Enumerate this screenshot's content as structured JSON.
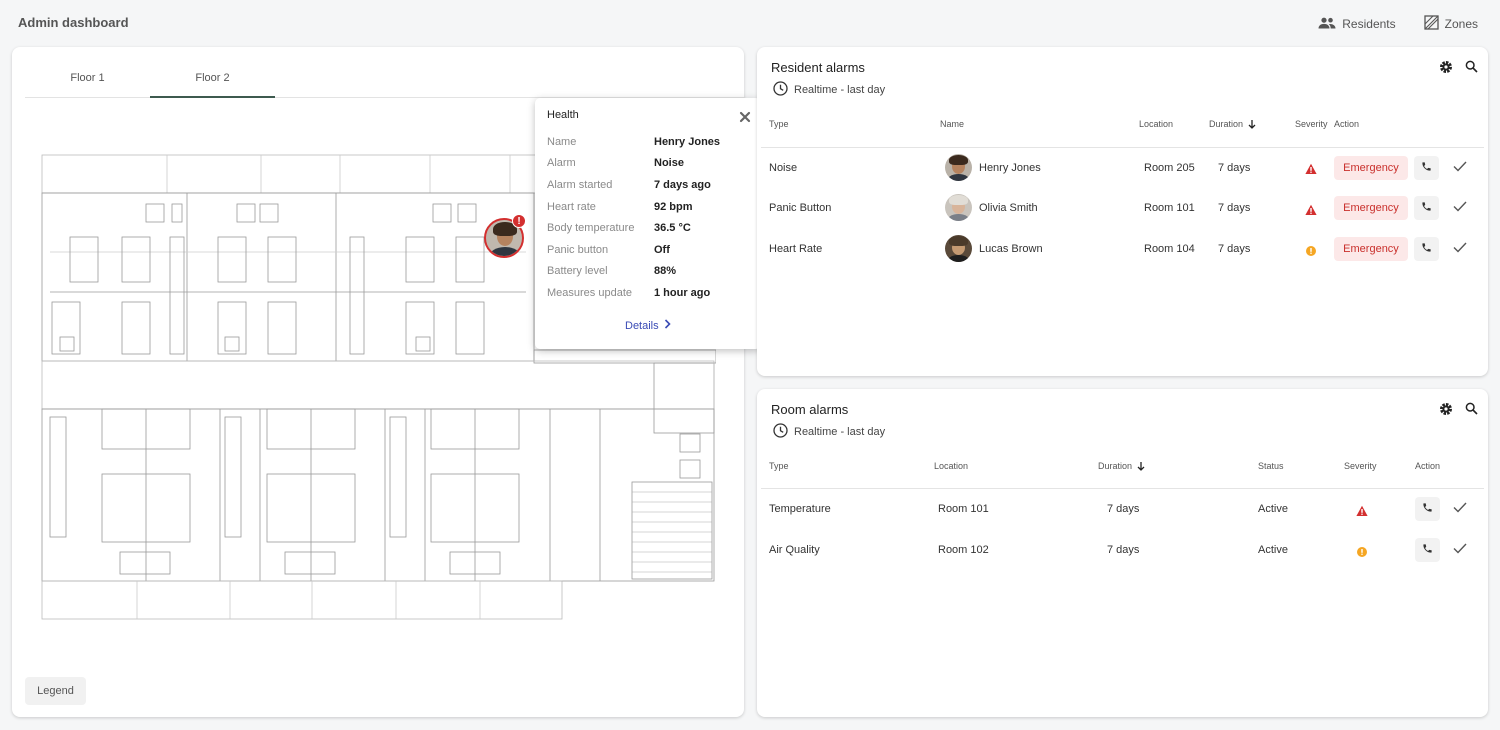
{
  "header": {
    "title": "Admin dashboard",
    "nav": [
      {
        "label": "Residents",
        "icon": "people-icon"
      },
      {
        "label": "Zones",
        "icon": "zones-icon"
      }
    ]
  },
  "map": {
    "tabs": [
      {
        "label": "Floor 1",
        "active": false
      },
      {
        "label": "Floor 2",
        "active": true
      }
    ],
    "legend_label": "Legend",
    "popup": {
      "title": "Health",
      "rows": [
        {
          "label": "Name",
          "value": "Henry Jones"
        },
        {
          "label": "Alarm",
          "value": "Noise"
        },
        {
          "label": "Alarm started",
          "value": "7 days ago"
        },
        {
          "label": "Heart rate",
          "value": "92 bpm"
        },
        {
          "label": "Body temperature",
          "value": "36.5 °C"
        },
        {
          "label": "Panic button",
          "value": "Off"
        },
        {
          "label": "Battery level",
          "value": "88%"
        },
        {
          "label": "Measures update",
          "value": "1 hour ago"
        }
      ],
      "details_label": "Details",
      "badge": "!"
    }
  },
  "resident_alarms": {
    "title": "Resident alarms",
    "subtitle": "Realtime - last day",
    "columns": {
      "type": "Type",
      "name": "Name",
      "location": "Location",
      "duration": "Duration",
      "severity": "Severity",
      "action": "Action"
    },
    "rows": [
      {
        "type": "Noise",
        "name": "Henry Jones",
        "location": "Room 205",
        "duration": "7 days",
        "severity": "high",
        "action_label": "Emergency"
      },
      {
        "type": "Panic Button",
        "name": "Olivia Smith",
        "location": "Room 101",
        "duration": "7 days",
        "severity": "high",
        "action_label": "Emergency"
      },
      {
        "type": "Heart Rate",
        "name": "Lucas Brown",
        "location": "Room 104",
        "duration": "7 days",
        "severity": "medium",
        "action_label": "Emergency"
      }
    ]
  },
  "room_alarms": {
    "title": "Room alarms",
    "subtitle": "Realtime - last day",
    "columns": {
      "type": "Type",
      "location": "Location",
      "duration": "Duration",
      "status": "Status",
      "severity": "Severity",
      "action": "Action"
    },
    "rows": [
      {
        "type": "Temperature",
        "location": "Room 101",
        "duration": "7 days",
        "status": "Active",
        "severity": "high"
      },
      {
        "type": "Air Quality",
        "location": "Room 102",
        "duration": "7 days",
        "status": "Active",
        "severity": "medium"
      }
    ]
  },
  "colors": {
    "high": "#d32f2f",
    "medium": "#f5a623",
    "tab_active": "#3d5a4f",
    "link": "#3a4bb5",
    "emergency_bg": "#fce8e8",
    "emergency_text": "#c9302c"
  }
}
